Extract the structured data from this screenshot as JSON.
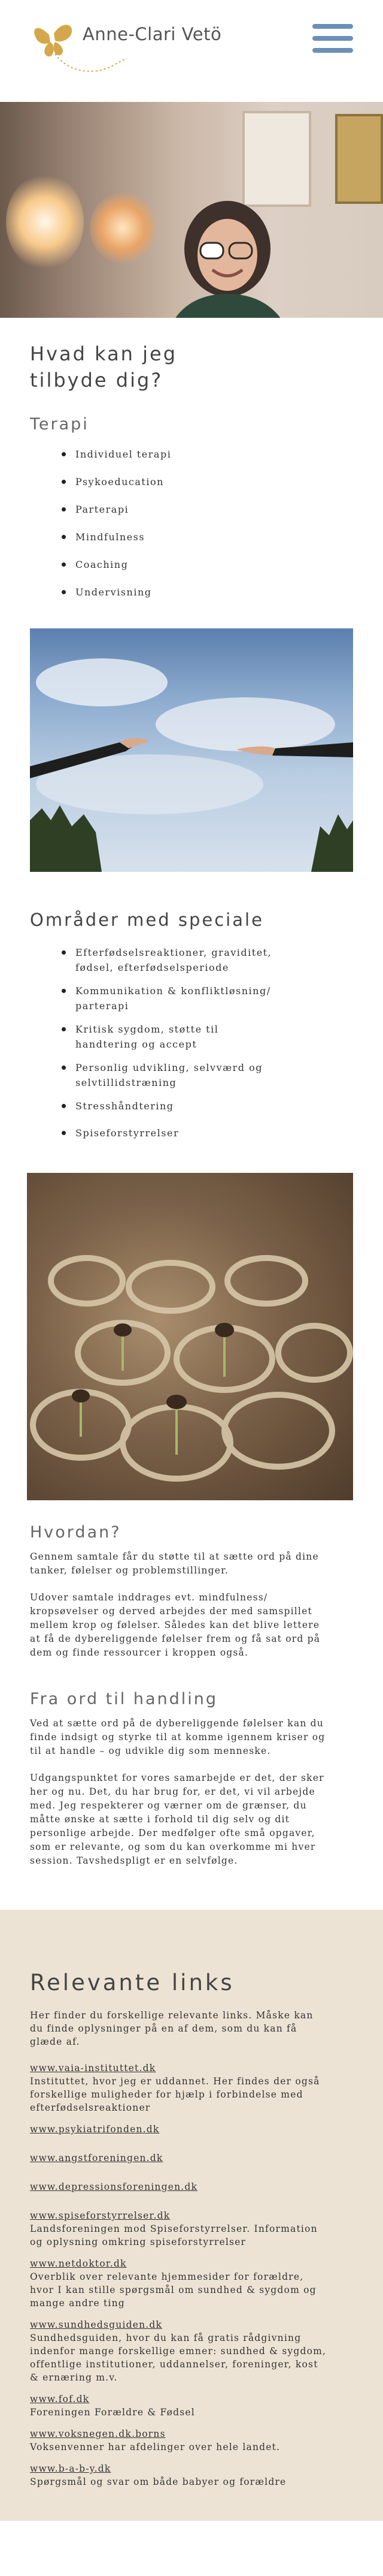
{
  "header": {
    "brand": "Anne-Clari Vetö",
    "menu_icon": "hamburger-menu-icon",
    "logo_icon": "butterfly-logo-icon",
    "accent_color": "#6a8fb8",
    "logo_color": "#d4a84a"
  },
  "offer": {
    "title_line1": "Hvad kan jeg",
    "title_line2": "tilbyde dig?",
    "therapy_title": "Terapi",
    "therapy_items": [
      "Individuel terapi",
      "Psykoeducation",
      "Parterapi",
      "Mindfulness",
      "Coaching",
      "Undervisning"
    ]
  },
  "special": {
    "title": "Områder med speciale",
    "items": [
      [
        "Efterfødselsreaktioner, graviditet,",
        "fødsel, efterfødselsperiode"
      ],
      [
        "Kommunikation & konfliktløsning/",
        "parterapi"
      ],
      [
        "Kritisk sygdom, støtte til",
        "handtering og accept"
      ],
      [
        "Personlig udvikling, selvværd og",
        "selvtillidstræning"
      ],
      [
        "Stresshåndtering"
      ],
      [
        "Spiseforstyrrelser"
      ]
    ]
  },
  "how": {
    "title": "Hvordan?",
    "p1": [
      "Gennem samtale får du støtte til at sætte ord på dine",
      "tanker, følelser og problemstillinger."
    ],
    "p2": [
      "Udover samtale inddrages evt. mindfulness/",
      "kropsøvelser og derved arbejdes der med samspillet",
      "mellem krop og følelser. Således kan det blive lettere",
      "at få de dybereliggende følelser frem og få sat ord på",
      "dem og finde ressourcer i kroppen også."
    ]
  },
  "action": {
    "title": "Fra ord til handling",
    "p1": [
      "Ved at sætte ord på de dybereliggende følelser kan du",
      "finde indsigt og styrke til at komme igennem kriser og",
      "til at handle – og udvikle dig som menneske."
    ],
    "p2": [
      "Udgangspunktet for vores samarbejde er det, der sker",
      "her og nu. Det, du har brug for, er det, vi vil arbejde",
      "med. Jeg respekterer og værner om de grænser, du",
      "måtte ønske at sætte i forhold til dig selv og dit",
      "personlige arbejde. Der medfølger ofte små opgaver,",
      "som er relevante, og som du kan overkomme mi hver",
      "session. Tavshedspligt er en selvfølge."
    ]
  },
  "links": {
    "title": "Relevante links",
    "intro": [
      "Her finder du forskellige relevante links. Måske kan",
      "du finde oplysninger på en af dem, som du kan få",
      "glæde af."
    ],
    "entries": [
      {
        "url": "www.vaia-instituttet.dk",
        "desc": [
          "Instituttet, hvor jeg er uddannet. Her findes der også",
          "forskellige muligheder for hjælp i forbindelse med",
          "efterfødselsreaktioner"
        ]
      },
      {
        "url": "www.psykiatrifonden.dk",
        "desc": []
      },
      {
        "url": "www.angstforeningen.dk",
        "desc": []
      },
      {
        "url": "www.depressionsforeningen.dk",
        "desc": []
      },
      {
        "url": "www.spiseforstyrrelser.dk",
        "desc": [
          "Landsforeningen mod Spiseforstyrrelser. Information",
          "og oplysning omkring spiseforstyrrelser"
        ]
      },
      {
        "url": "www.netdoktor.dk",
        "desc": [
          "Overblik over relevante hjemmesider for forældre,",
          "hvor I kan stille spørgsmål om sundhed & sygdom og",
          "mange andre ting"
        ]
      },
      {
        "url": "www.sundhedsguiden.dk",
        "desc": [
          "Sundhedsguiden, hvor du kan få gratis rådgivning",
          "indenfor mange forskellige emner: sundhed & sygdom,",
          "offentlige institutioner, uddannelser, foreninger, kost",
          "& ernæring m.v."
        ]
      },
      {
        "url": "www.fof.dk",
        "desc": [
          "Foreningen Forældre & Fødsel"
        ]
      },
      {
        "url": "www.voksnegen.dk.borns",
        "desc": [
          "Voksenvenner har afdelinger over hele landet."
        ]
      },
      {
        "url": "www.b-a-b-y.dk",
        "desc": [
          "Spørgsmål og svar om både babyer og forældre"
        ]
      }
    ]
  }
}
